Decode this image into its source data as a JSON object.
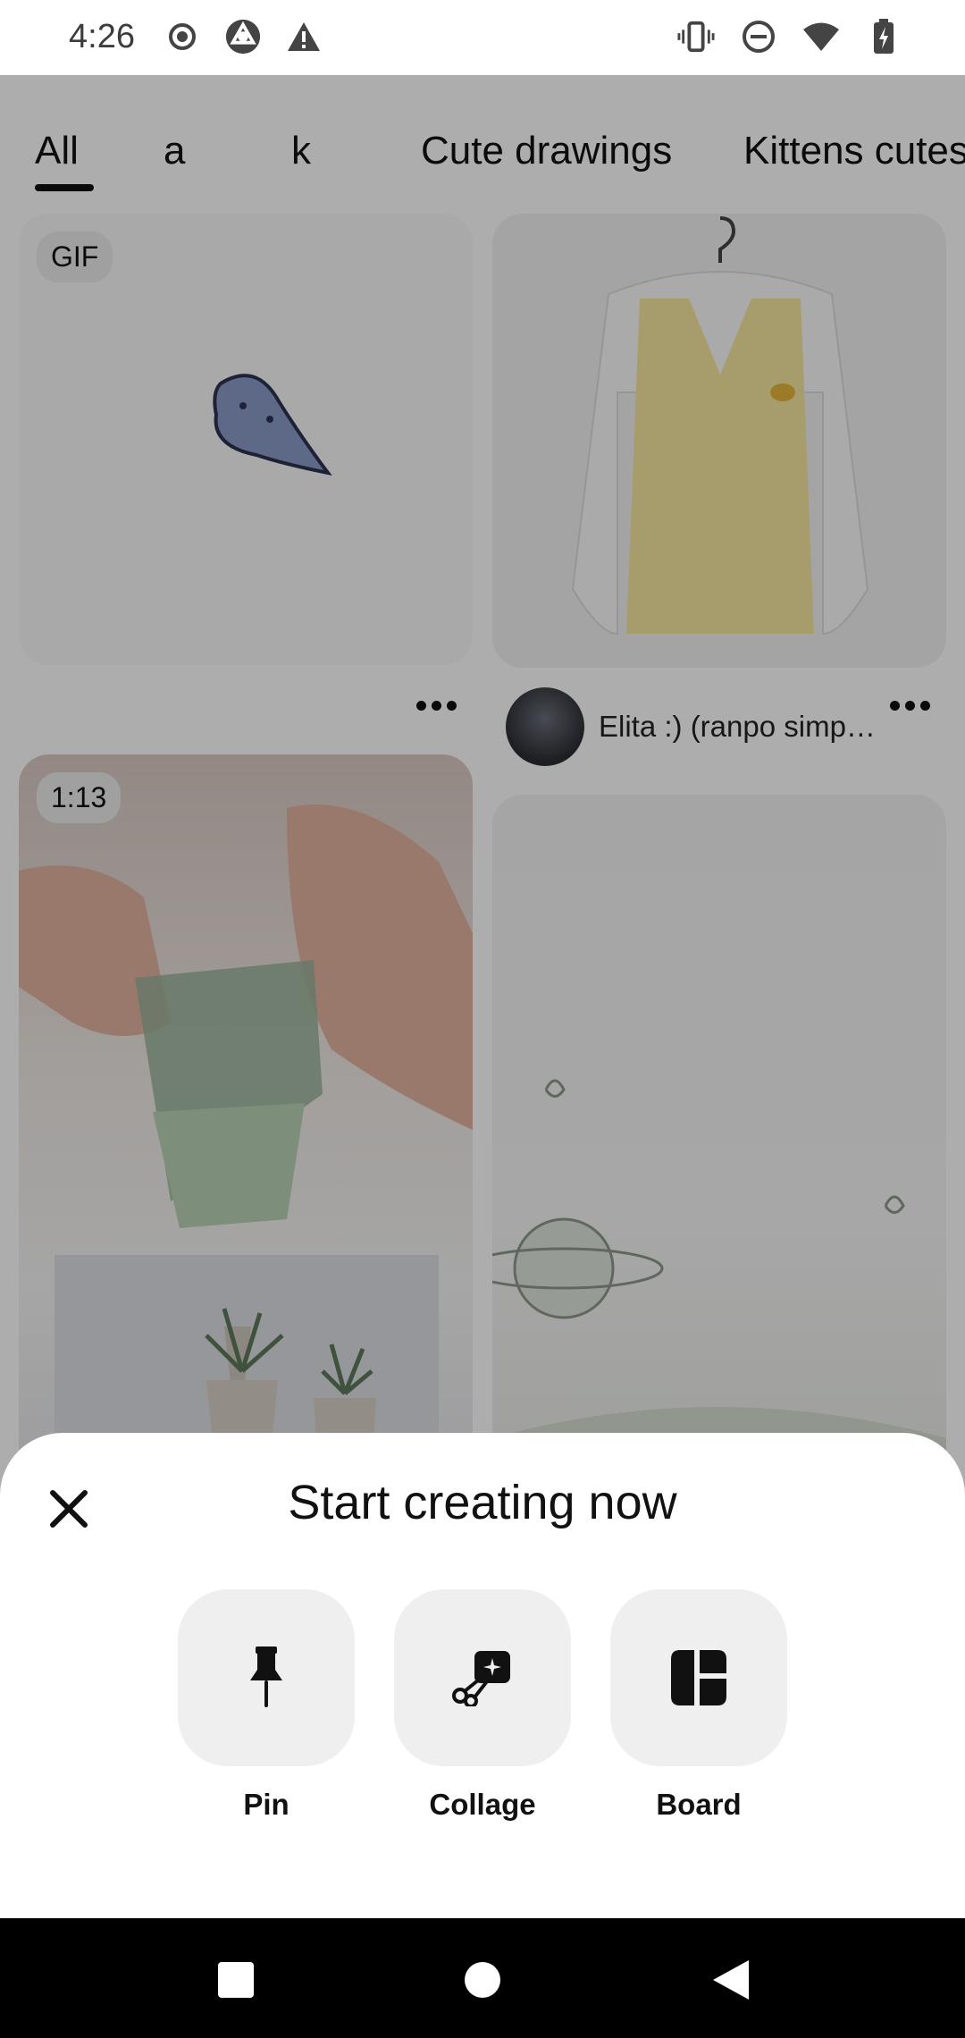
{
  "status_bar": {
    "time": "4:26",
    "left_icons": [
      "record-icon",
      "browser-icon",
      "warning-icon"
    ],
    "right_icons": [
      "vibrate-icon",
      "do-not-disturb-icon",
      "wifi-icon",
      "battery-charging-icon"
    ]
  },
  "feed": {
    "tabs": [
      {
        "label": "All",
        "selected": true
      },
      {
        "label": "a",
        "selected": false
      },
      {
        "label": "k",
        "selected": false
      },
      {
        "label": "Cute drawings",
        "selected": false
      },
      {
        "label": "Kittens cutes",
        "selected": false
      }
    ],
    "pins": [
      {
        "badge": "GIF",
        "image": "blue bird sticker"
      },
      {
        "image": "yellow knit vest with white blouse",
        "author": "Elita :) (ranpo simp…"
      },
      {
        "badge": "1:13",
        "image": "hands folding paper plant pot"
      },
      {
        "image": "pastel room illustration with planet"
      }
    ]
  },
  "bottom_sheet": {
    "title": "Start creating now",
    "close_icon": "close-icon",
    "actions": [
      {
        "label": "Pin",
        "icon": "pushpin-icon"
      },
      {
        "label": "Collage",
        "icon": "collage-scissors-icon"
      },
      {
        "label": "Board",
        "icon": "board-grid-icon"
      }
    ]
  },
  "nav_bar": {
    "buttons": [
      "recents-button",
      "home-button",
      "back-button"
    ]
  },
  "colors": {
    "scrim": "rgba(0,0,0,0.32)",
    "tile_bg": "#efefef",
    "text": "#111111"
  }
}
